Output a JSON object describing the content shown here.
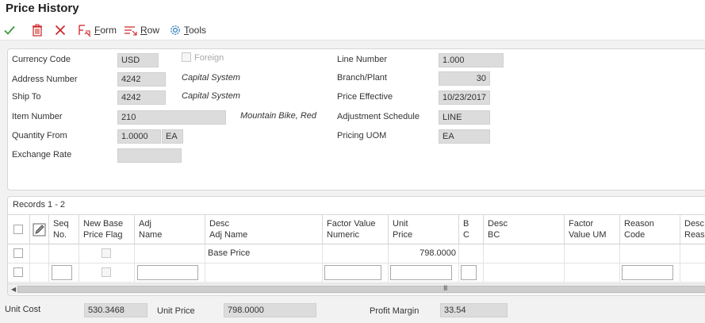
{
  "window": {
    "title": "Price History"
  },
  "toolbar": {
    "ok_icon": "check-icon",
    "delete_icon": "trash-icon",
    "cancel_icon": "close-icon",
    "form_label_pre": "",
    "form_label_u": "F",
    "form_label_post": "orm",
    "row_label_u": "R",
    "row_label_post": "ow",
    "tools_label_u": "T",
    "tools_label_post": "ools"
  },
  "form": {
    "currency_code": {
      "label": "Currency Code",
      "value": "USD"
    },
    "foreign": {
      "label": "Foreign",
      "checked": false
    },
    "address_number": {
      "label": "Address Number",
      "value": "4242",
      "desc": "Capital System"
    },
    "ship_to": {
      "label": "Ship To",
      "value": "4242",
      "desc": "Capital System"
    },
    "item_number": {
      "label": "Item Number",
      "value": "210",
      "desc": "Mountain Bike, Red"
    },
    "quantity_from": {
      "label": "Quantity From",
      "value": "1.0000",
      "uom": "EA"
    },
    "exchange_rate": {
      "label": "Exchange Rate",
      "value": ""
    },
    "line_number": {
      "label": "Line Number",
      "value": "1.000"
    },
    "branch_plant": {
      "label": "Branch/Plant",
      "value": "30"
    },
    "price_effective": {
      "label": "Price Effective",
      "value": "10/23/2017"
    },
    "adjustment_schedule": {
      "label": "Adjustment Schedule",
      "value": "LINE"
    },
    "pricing_uom": {
      "label": "Pricing UOM",
      "value": "EA"
    }
  },
  "grid": {
    "records_label": "Records 1 - 2",
    "columns": [
      "Seq\nNo.",
      "New Base\nPrice Flag",
      "Adj\nName",
      "Desc\nAdj Name",
      "Factor Value\nNumeric",
      "Unit\nPrice",
      "B\nC",
      "Desc\nBC",
      "Factor\nValue UM",
      "Reason\nCode",
      "Desc\nReason"
    ],
    "rows": [
      {
        "desc_adj_name": "Base Price",
        "unit_price": "798.0000"
      }
    ],
    "scroll_grip": "III"
  },
  "footer": {
    "unit_cost": {
      "label": "Unit Cost",
      "value": "530.3468"
    },
    "unit_price": {
      "label": "Unit Price",
      "value": "798.0000"
    },
    "profit_margin": {
      "label": "Profit Margin",
      "value": "33.54"
    }
  },
  "colors": {
    "ok": "#3a9a3a",
    "delete": "#cc2222",
    "cancel": "#cc2222",
    "link": "#333333"
  }
}
